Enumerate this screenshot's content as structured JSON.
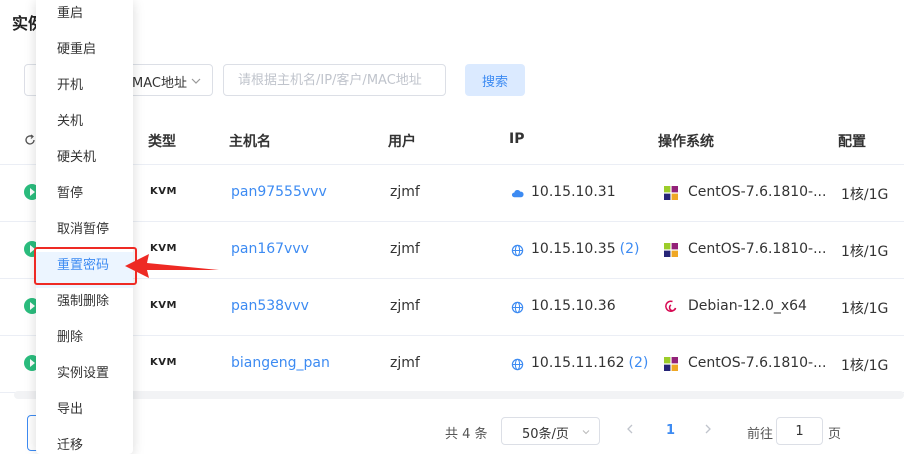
{
  "page": {
    "title": "实例"
  },
  "filters": {
    "select_value": "MAC地址",
    "search_placeholder": "请根据主机名/IP/客户/MAC地址",
    "search_button": "搜索"
  },
  "table": {
    "columns": [
      "类型",
      "主机名",
      "用户",
      "IP",
      "操作系统",
      "配置"
    ],
    "rows": [
      {
        "type": "KVM",
        "hostname": "pan97555vvv",
        "user": "zjmf",
        "ip": "10.15.10.31",
        "ip_extra": "",
        "ip_icon": "cloud-icon",
        "os": "CentOS-7.6.1810-...",
        "os_icon": "centos-icon",
        "config": "1核/1G"
      },
      {
        "type": "KVM",
        "hostname": "pan167vvv",
        "user": "zjmf",
        "ip": "10.15.10.35",
        "ip_extra": "(2)",
        "ip_icon": "globe-icon",
        "os": "CentOS-7.6.1810-...",
        "os_icon": "centos-icon",
        "config": "1核/1G"
      },
      {
        "type": "KVM",
        "hostname": "pan538vvv",
        "user": "zjmf",
        "ip": "10.15.10.36",
        "ip_extra": "",
        "ip_icon": "globe-icon",
        "os": "Debian-12.0_x64",
        "os_icon": "debian-icon",
        "config": "1核/1G"
      },
      {
        "type": "KVM",
        "hostname": "biangeng_pan",
        "user": "zjmf",
        "ip": "10.15.11.162",
        "ip_extra": "(2)",
        "ip_icon": "globe-icon",
        "os": "CentOS-7.6.1810-...",
        "os_icon": "centos-icon",
        "config": "1核/1G"
      }
    ]
  },
  "pagination": {
    "total": "共 4 条",
    "page_size": "50条/页",
    "current_page": "1",
    "goto_label": "前往",
    "goto_value": "1",
    "page_suffix": "页"
  },
  "menu": {
    "items": [
      "重启",
      "硬重启",
      "开机",
      "关机",
      "硬关机",
      "暂停",
      "取消暂停",
      "重置密码",
      "强制删除",
      "删除",
      "实例设置",
      "导出",
      "迁移"
    ],
    "active_index": 7
  },
  "colors": {
    "accent": "#3d8bf2",
    "highlight": "#ee2a24",
    "status": "#2bbd7e"
  }
}
